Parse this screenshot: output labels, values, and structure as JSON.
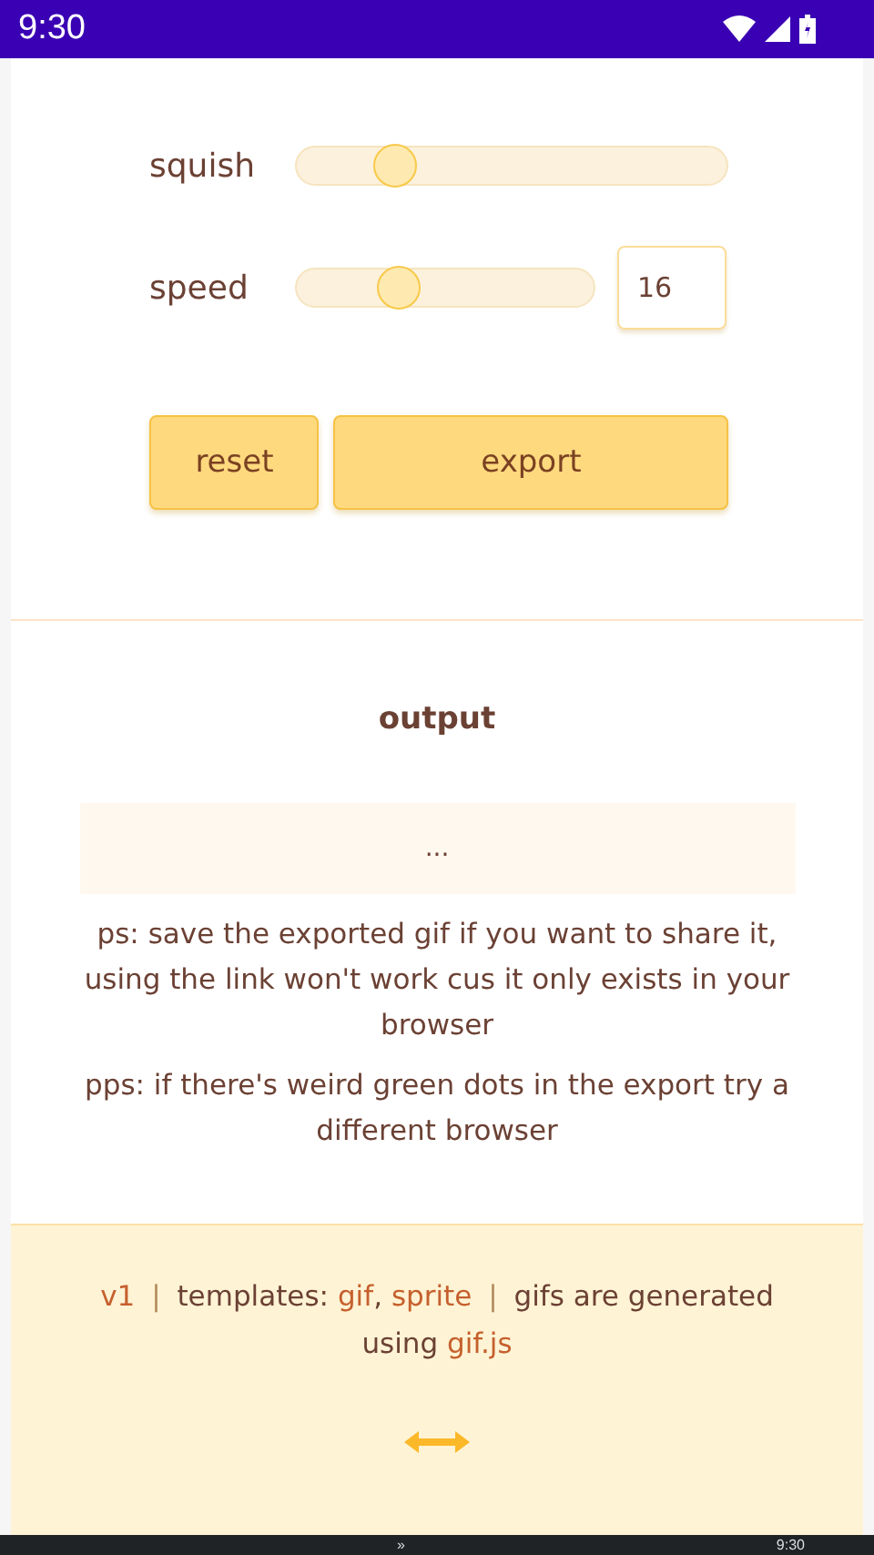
{
  "status_bar": {
    "time": "9:30"
  },
  "controls": [
    {
      "kind": "slider",
      "label": "squish",
      "level": 0.2
    },
    {
      "kind": "slider_number",
      "label": "speed",
      "level": 0.32,
      "value": "16"
    }
  ],
  "buttons": [
    {
      "label": "reset",
      "kind": "small"
    },
    {
      "label": "export",
      "kind": "wide"
    }
  ],
  "output": {
    "heading": "output",
    "result": "..."
  },
  "notes": [
    "ps: save the exported gif if you want to share it, using the link won't work cus it only exists in your browser",
    "pps: if there's weird green dots in the export try a different browser"
  ],
  "footer": {
    "parts": [
      {
        "kind": "link",
        "text": "v1"
      },
      {
        "kind": "separator",
        "text": "|"
      },
      {
        "kind": "text",
        "text": "templates:"
      },
      {
        "kind": "link",
        "text": "gif"
      },
      {
        "kind": "text",
        "text": ","
      },
      {
        "kind": "link",
        "text": "sprite"
      },
      {
        "kind": "separator",
        "text": "|"
      },
      {
        "kind": "text",
        "text": "gifs are generated using"
      },
      {
        "kind": "link",
        "text": "gif.js"
      }
    ]
  },
  "taskbar": {
    "chevron": "»",
    "clock": "9:30"
  }
}
